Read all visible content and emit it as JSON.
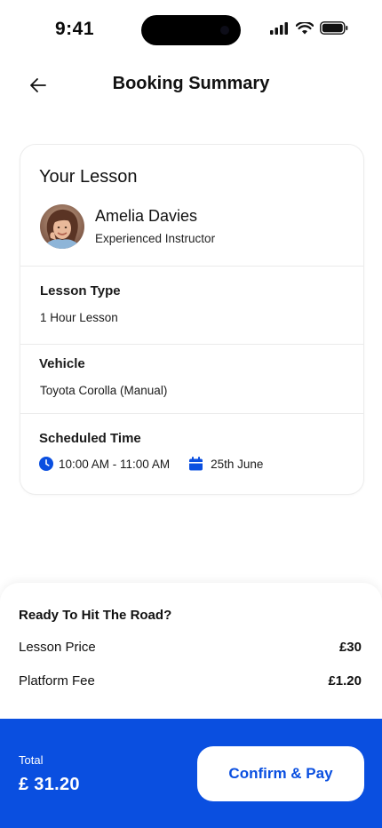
{
  "status_bar": {
    "time": "9:41"
  },
  "header": {
    "title": "Booking Summary"
  },
  "lesson_card": {
    "title": "Your Lesson",
    "instructor": {
      "name": "Amelia Davies",
      "role": "Experienced Instructor"
    },
    "lesson_type": {
      "label": "Lesson Type",
      "value": "1 Hour Lesson"
    },
    "vehicle": {
      "label": "Vehicle",
      "value": "Toyota Corolla (Manual)"
    },
    "scheduled_time": {
      "label": "Scheduled Time",
      "time": "10:00 AM - 11:00 AM",
      "date": "25th June"
    }
  },
  "summary": {
    "title": "Ready To Hit The Road?",
    "lines": [
      {
        "label": "Lesson Price",
        "amount": "£30"
      },
      {
        "label": "Platform Fee",
        "amount": "£1.20"
      }
    ]
  },
  "footer": {
    "total_label": "Total",
    "total_value": "£ 31.20",
    "confirm_label": "Confirm & Pay"
  },
  "colors": {
    "accent": "#0a4fe0",
    "background": "#ffffff",
    "text": "#121212"
  },
  "icons": [
    "back-arrow-icon",
    "signal-icon",
    "wifi-icon",
    "battery-icon",
    "clock-icon",
    "calendar-icon"
  ]
}
